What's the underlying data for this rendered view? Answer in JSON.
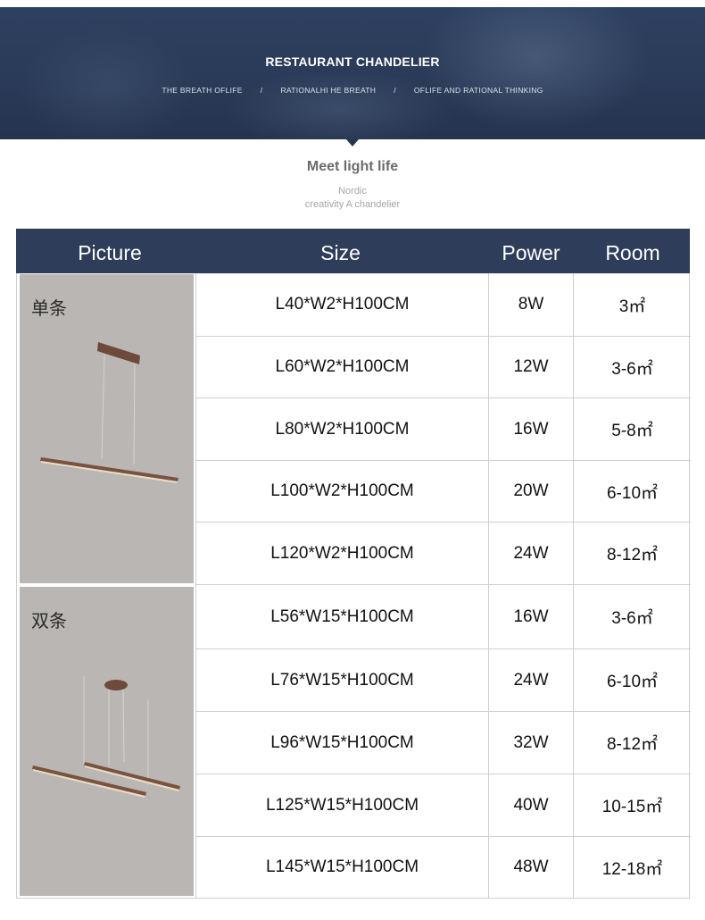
{
  "banner": {
    "title": "RESTAURANT CHANDELIER",
    "subtitle_parts": [
      "THE BREATH OFLIFE",
      "/",
      "RATIONALHI HE BREATH",
      "/",
      "OFLIFE AND RATIONAL THINKING"
    ]
  },
  "heading": {
    "title": "Meet light life",
    "line1": "Nordic",
    "line2": "creativity A chandelier"
  },
  "table": {
    "headers": {
      "picture": "Picture",
      "size": "Size",
      "power": "Power",
      "room": "Room"
    },
    "groups": [
      {
        "label": "单条",
        "image": "single-bar-pendant-light"
      },
      {
        "label": "双条",
        "image": "double-bar-pendant-light"
      }
    ],
    "rows": [
      {
        "size": "L40*W2*H100CM",
        "power": "8W",
        "room": "3㎡"
      },
      {
        "size": "L60*W2*H100CM",
        "power": "12W",
        "room": "3-6㎡"
      },
      {
        "size": "L80*W2*H100CM",
        "power": "16W",
        "room": "5-8㎡"
      },
      {
        "size": "L100*W2*H100CM",
        "power": "20W",
        "room": "6-10㎡"
      },
      {
        "size": "L120*W2*H100CM",
        "power": "24W",
        "room": "8-12㎡"
      },
      {
        "size": "L56*W15*H100CM",
        "power": "16W",
        "room": "3-6㎡"
      },
      {
        "size": "L76*W15*H100CM",
        "power": "24W",
        "room": "6-10㎡"
      },
      {
        "size": "L96*W15*H100CM",
        "power": "32W",
        "room": "8-12㎡"
      },
      {
        "size": "L125*W15*H100CM",
        "power": "40W",
        "room": "10-15㎡"
      },
      {
        "size": "L145*W15*H100CM",
        "power": "48W",
        "room": "12-18㎡"
      }
    ]
  },
  "colors": {
    "header_bg": "#2d3d5a",
    "banner_bg": "#2a3b58",
    "picture_bg": "#b9b6b3",
    "lamp_wood": "#6e4a3a"
  }
}
